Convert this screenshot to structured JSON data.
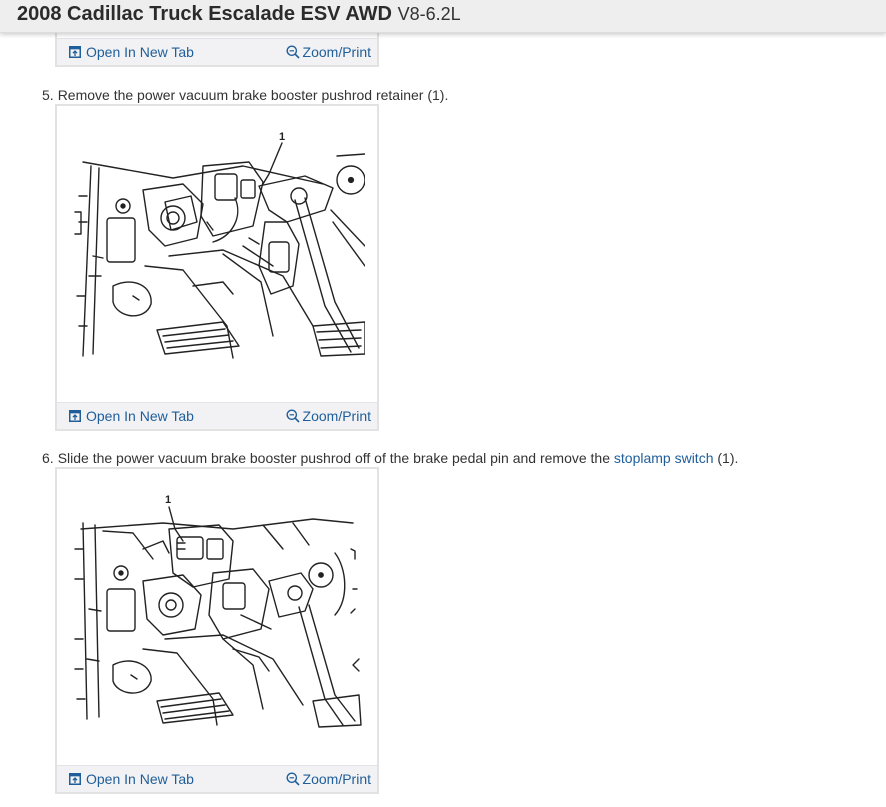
{
  "header": {
    "title": "2008 Cadillac Truck Escalade ESV AWD",
    "engine": "V8-6.2L"
  },
  "toolbar": {
    "open_label": "Open In New Tab",
    "zoom_label": "Zoom/Print"
  },
  "steps": [
    {
      "number": "5.",
      "text": "Remove the power vacuum brake booster pushrod retainer (1).",
      "callout": "1"
    },
    {
      "number": "6.",
      "text_before": "Slide the power vacuum brake booster pushrod off of the brake pedal pin and remove the",
      "link": "stoplamp switch",
      "text_after": "(1).",
      "callout": "1"
    }
  ],
  "colors": {
    "link": "#1f5e9a",
    "header_bg": "#eeeeee",
    "toolbar_bg": "#f2f2f4"
  },
  "icons": [
    "open-in-new-tab-icon",
    "zoom-icon"
  ]
}
